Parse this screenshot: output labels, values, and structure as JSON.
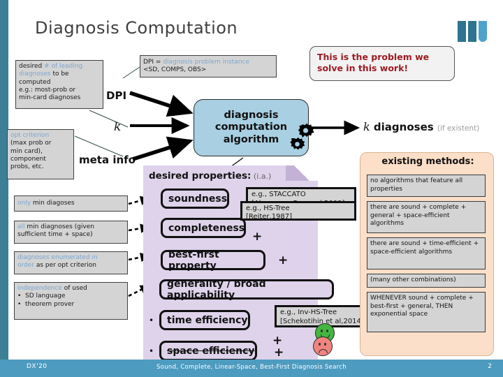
{
  "slide": {
    "title": "Diagnosis Computation",
    "logo_name": "university-logo"
  },
  "footer": {
    "left": "DX'20",
    "center": "Sound, Complete, Linear-Space, Best-First Diagnosis Search",
    "right": "2"
  },
  "inputs": {
    "dpi_label": "DPI",
    "k_label": "k",
    "meta_label": "meta info",
    "dpi_note": {
      "prefix": "DPI = ",
      "highlight": "diagnosis problem instance",
      "second_line": "<SD, COMPS, OBS>"
    },
    "k_note": {
      "line1_plain": "desired ",
      "line1_highlight": "# of leading",
      "line2_highlight": "diagnoses",
      "line2_plain": " to be",
      "line3": "computed",
      "line4": "e.g.: most-prob or",
      "line5": "min-card diagnoses"
    },
    "meta_note": {
      "highlight": "opt criterion",
      "line2": "(max prob or",
      "line3": "min card),",
      "line4": "component",
      "line5": "probs, etc."
    }
  },
  "callout": {
    "line1": "This is the problem we",
    "line2": "solve in this work!",
    "color": "#9e1b22"
  },
  "algorithm": {
    "line1": "diagnosis",
    "line2": "computation",
    "line3": "algorithm",
    "fill": "#a8cfe2",
    "gears_icon": "gears-icon"
  },
  "output": {
    "k": "k",
    "word": " diagnoses ",
    "qualifier": "(if existent)"
  },
  "properties_panel": {
    "title": "desired properties:",
    "title_suffix": " (i.a.)",
    "fill": "#ded3ea",
    "items": [
      {
        "label": "soundness",
        "struck": false,
        "bullet": ""
      },
      {
        "label": "completeness",
        "struck": false,
        "bullet": ""
      },
      {
        "label": "best-first property",
        "struck": false,
        "bullet": ""
      },
      {
        "label": "generality / broad applicability",
        "struck": false,
        "bullet": ""
      },
      {
        "label": "time efficiency",
        "struck": false,
        "bullet": "•"
      },
      {
        "label": "space efficiency",
        "struck": true,
        "bullet": "•"
      }
    ],
    "plus_signs": [
      "+",
      "+",
      "+",
      "+"
    ]
  },
  "explanations": [
    {
      "line1_plain_pre": "",
      "highlight": "only",
      "rest": " min diagoses",
      "line2": ""
    },
    {
      "highlight": "all",
      "rest": " min diagnoses (given",
      "line2": "sufficient time + space)"
    },
    {
      "highlight": "diagnoses enumerated in",
      "highlight2": "order",
      "rest": " as per opt criterion"
    },
    {
      "highlight": "independence",
      "rest": " of used",
      "b1": "SD language",
      "b2": "theorem prover"
    }
  ],
  "tags": [
    {
      "line1": "e.g., STACCATO",
      "line2": "[Abreu,van Gemund,2009]"
    },
    {
      "line1": "e.g., HS-Tree",
      "line2": "[Reiter,1987]"
    },
    {
      "line1": "e.g., Inv-HS-Tree",
      "line2": "[Schekotihin et al,2014]"
    }
  ],
  "existing_methods": {
    "title": "existing methods:",
    "fill": "#fbdfc8",
    "boxes": [
      "no algorithms that feature all properties",
      "there are sound + complete + general + space-efficient algorithms",
      "there are sound + time-efficient + space-efficient algorithms",
      "(many other combinations)",
      "WHENEVER sound + complete + best-first + general, THEN exponential space"
    ]
  },
  "faces": {
    "happy": "happy-face-icon",
    "sad": "sad-face-icon"
  }
}
